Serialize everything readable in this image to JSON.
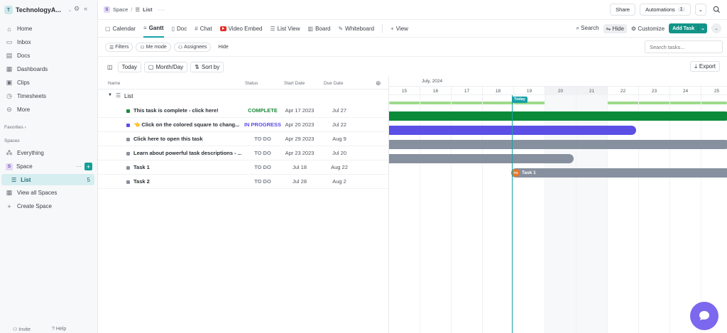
{
  "sidebar": {
    "workspace": {
      "badge": "T",
      "name": "TechnologyA..."
    },
    "nav": [
      {
        "label": "Home",
        "icon": "home-icon"
      },
      {
        "label": "Inbox",
        "icon": "inbox-icon"
      },
      {
        "label": "Docs",
        "icon": "docs-icon"
      },
      {
        "label": "Dashboards",
        "icon": "dashboards-icon"
      },
      {
        "label": "Clips",
        "icon": "clips-icon"
      },
      {
        "label": "Timesheets",
        "icon": "timesheets-icon"
      },
      {
        "label": "More",
        "icon": "more-icon"
      }
    ],
    "favorites": "Favorites",
    "spaces": "Spaces",
    "everything": "Everything",
    "space": {
      "badge": "S",
      "name": "Space"
    },
    "list": {
      "name": "List",
      "count": "5"
    },
    "view_all": "View all Spaces",
    "create_space": "Create Space",
    "invite": "Invite",
    "help": "Help"
  },
  "breadcrumb": {
    "space_badge": "S",
    "space": "Space",
    "separator": "/",
    "list": "List",
    "more": "···"
  },
  "topbar": {
    "share": "Share",
    "automations": "Automations",
    "automations_count": "1"
  },
  "views": {
    "tabs": [
      {
        "label": "Calendar",
        "icon": "calendar-icon"
      },
      {
        "label": "Gantt",
        "icon": "gantt-icon",
        "active": true
      },
      {
        "label": "Doc",
        "icon": "doc-icon"
      },
      {
        "label": "Chat",
        "icon": "hash-icon"
      },
      {
        "label": "Video Embed",
        "icon": "youtube-icon"
      },
      {
        "label": "List View",
        "icon": "list-icon"
      },
      {
        "label": "Board",
        "icon": "board-icon"
      },
      {
        "label": "Whiteboard",
        "icon": "whiteboard-icon"
      }
    ],
    "add_view": "View",
    "search": "Search",
    "hide": "Hide",
    "customize": "Customize",
    "add_task": "Add Task"
  },
  "filters": {
    "filters": "Filters",
    "me_mode": "Me mode",
    "assignees": "Assignees",
    "hide": "Hide",
    "search_placeholder": "Search tasks..."
  },
  "toolbar": {
    "today": "Today",
    "scale": "Month/Day",
    "sort": "Sort by",
    "export": "Export"
  },
  "table": {
    "headers": {
      "name": "Name",
      "status": "Status",
      "start": "Start Date",
      "due": "Due Date"
    },
    "group": "List",
    "rows": [
      {
        "name": "This task is complete - click here!",
        "status": "COMPLETE",
        "status_color": "#1c8a3c",
        "sq_color": "#1c8a3c",
        "start": "Apr 17 2023",
        "due": "Jul 27"
      },
      {
        "name": "👈 Click on the colored square to chang...",
        "status": "IN PROGRESS",
        "status_color": "#5b4fe6",
        "sq_color": "#5b4fe6",
        "start": "Apr 20 2023",
        "due": "Jul 22"
      },
      {
        "name": "Click here to open this task",
        "status": "TO DO",
        "status_color": "#7c828d",
        "sq_color": "#87909e",
        "start": "Apr 29 2023",
        "due": "Aug 9"
      },
      {
        "name": "Learn about powerful task descriptions - ...",
        "status": "TO DO",
        "status_color": "#7c828d",
        "sq_color": "#87909e",
        "start": "Apr 23 2023",
        "due": "Jul 20"
      },
      {
        "name": "Task 1",
        "status": "TO DO",
        "status_color": "#7c828d",
        "sq_color": "#87909e",
        "start": "Jul 18",
        "due": "Aug 22"
      },
      {
        "name": "Task 2",
        "status": "TO DO",
        "status_color": "#7c828d",
        "sq_color": "#87909e",
        "start": "Jul 28",
        "due": "Aug 2"
      }
    ]
  },
  "gantt": {
    "month": "July, 2024",
    "days": [
      "15",
      "16",
      "17",
      "18",
      "19",
      "20",
      "21",
      "22",
      "23",
      "24",
      "25"
    ],
    "weekend": [
      "20",
      "21"
    ],
    "today_label": "Today",
    "task_avatar": "TG",
    "task_label": "Task 1",
    "bar_colors": [
      "#0b8a3a",
      "#5b4fe6",
      "#87909e",
      "#87909e",
      "#87909e"
    ]
  }
}
